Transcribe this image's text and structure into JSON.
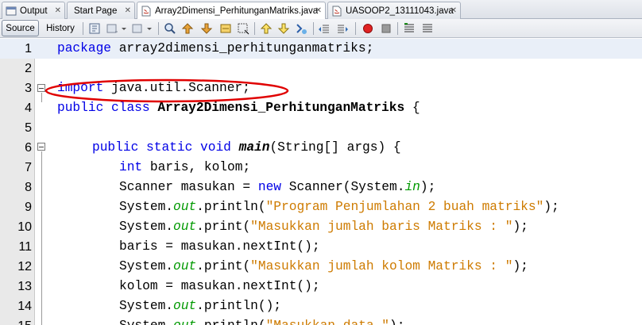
{
  "tabs": [
    {
      "label": "Output",
      "icon": "output-icon"
    },
    {
      "label": "Start Page",
      "icon": "start-page-icon"
    },
    {
      "label": "Array2Dimensi_PerhitunganMatriks.java",
      "icon": "java-file-icon",
      "active": true
    },
    {
      "label": "UASOOP2_13111043.java",
      "icon": "java-file-icon"
    }
  ],
  "close_glyph": "✕",
  "toolbar": {
    "source_label": "Source",
    "history_label": "History"
  },
  "colors": {
    "keyword": "#0000e6",
    "string": "#ce7b00",
    "static_field": "#009900",
    "highlight_line": "#e9eff8",
    "annotation": "#e00000"
  },
  "editor": {
    "lines": [
      {
        "n": "1",
        "indent": 0,
        "tokens": [
          {
            "t": "package",
            "c": "kw"
          },
          {
            "t": " array2dimensi_perhitunganmatriks;"
          }
        ]
      },
      {
        "n": "2",
        "indent": 0,
        "tokens": []
      },
      {
        "n": "3",
        "indent": 0,
        "tokens": [
          {
            "t": "import",
            "c": "kw"
          },
          {
            "t": " java.util.Scanner;"
          }
        ]
      },
      {
        "n": "4",
        "indent": 0,
        "tokens": [
          {
            "t": "public",
            "c": "kw"
          },
          {
            "t": " "
          },
          {
            "t": "class",
            "c": "kw"
          },
          {
            "t": " "
          },
          {
            "t": "Array2Dimensi_PerhitunganMatriks",
            "c": "bold"
          },
          {
            "t": " {"
          }
        ]
      },
      {
        "n": "5",
        "indent": 0,
        "tokens": []
      },
      {
        "n": "6",
        "indent": 1,
        "tokens": [
          {
            "t": "public",
            "c": "kw"
          },
          {
            "t": " "
          },
          {
            "t": "static",
            "c": "kw"
          },
          {
            "t": " "
          },
          {
            "t": "void",
            "c": "kw"
          },
          {
            "t": " "
          },
          {
            "t": "main",
            "c": "bi"
          },
          {
            "t": "(String[] args) {"
          }
        ]
      },
      {
        "n": "7",
        "indent": 2,
        "tokens": [
          {
            "t": "int",
            "c": "kw"
          },
          {
            "t": " baris, kolom;"
          }
        ]
      },
      {
        "n": "8",
        "indent": 2,
        "tokens": [
          {
            "t": "Scanner masukan = "
          },
          {
            "t": "new",
            "c": "kw"
          },
          {
            "t": " Scanner(System."
          },
          {
            "t": "in",
            "c": "fld"
          },
          {
            "t": ");"
          }
        ]
      },
      {
        "n": "9",
        "indent": 2,
        "tokens": [
          {
            "t": "System."
          },
          {
            "t": "out",
            "c": "fld"
          },
          {
            "t": ".println("
          },
          {
            "t": "\"Program Penjumlahan 2 buah matriks\"",
            "c": "str"
          },
          {
            "t": ");"
          }
        ]
      },
      {
        "n": "10",
        "indent": 2,
        "tokens": [
          {
            "t": "System."
          },
          {
            "t": "out",
            "c": "fld"
          },
          {
            "t": ".print("
          },
          {
            "t": "\"Masukkan jumlah baris Matriks : \"",
            "c": "str"
          },
          {
            "t": ");"
          }
        ]
      },
      {
        "n": "11",
        "indent": 2,
        "tokens": [
          {
            "t": "baris = masukan.nextInt();"
          }
        ]
      },
      {
        "n": "12",
        "indent": 2,
        "tokens": [
          {
            "t": "System."
          },
          {
            "t": "out",
            "c": "fld"
          },
          {
            "t": ".print("
          },
          {
            "t": "\"Masukkan jumlah kolom Matriks : \"",
            "c": "str"
          },
          {
            "t": ");"
          }
        ]
      },
      {
        "n": "13",
        "indent": 2,
        "tokens": [
          {
            "t": "kolom = masukan.nextInt();"
          }
        ]
      },
      {
        "n": "14",
        "indent": 2,
        "tokens": [
          {
            "t": "System."
          },
          {
            "t": "out",
            "c": "fld"
          },
          {
            "t": ".println();"
          }
        ]
      },
      {
        "n": "15",
        "indent": 2,
        "tokens": [
          {
            "t": "System."
          },
          {
            "t": "out",
            "c": "fld"
          },
          {
            "t": ".println("
          },
          {
            "t": "\"Masukkan data \"",
            "c": "str"
          },
          {
            "t": ");"
          }
        ]
      }
    ]
  }
}
